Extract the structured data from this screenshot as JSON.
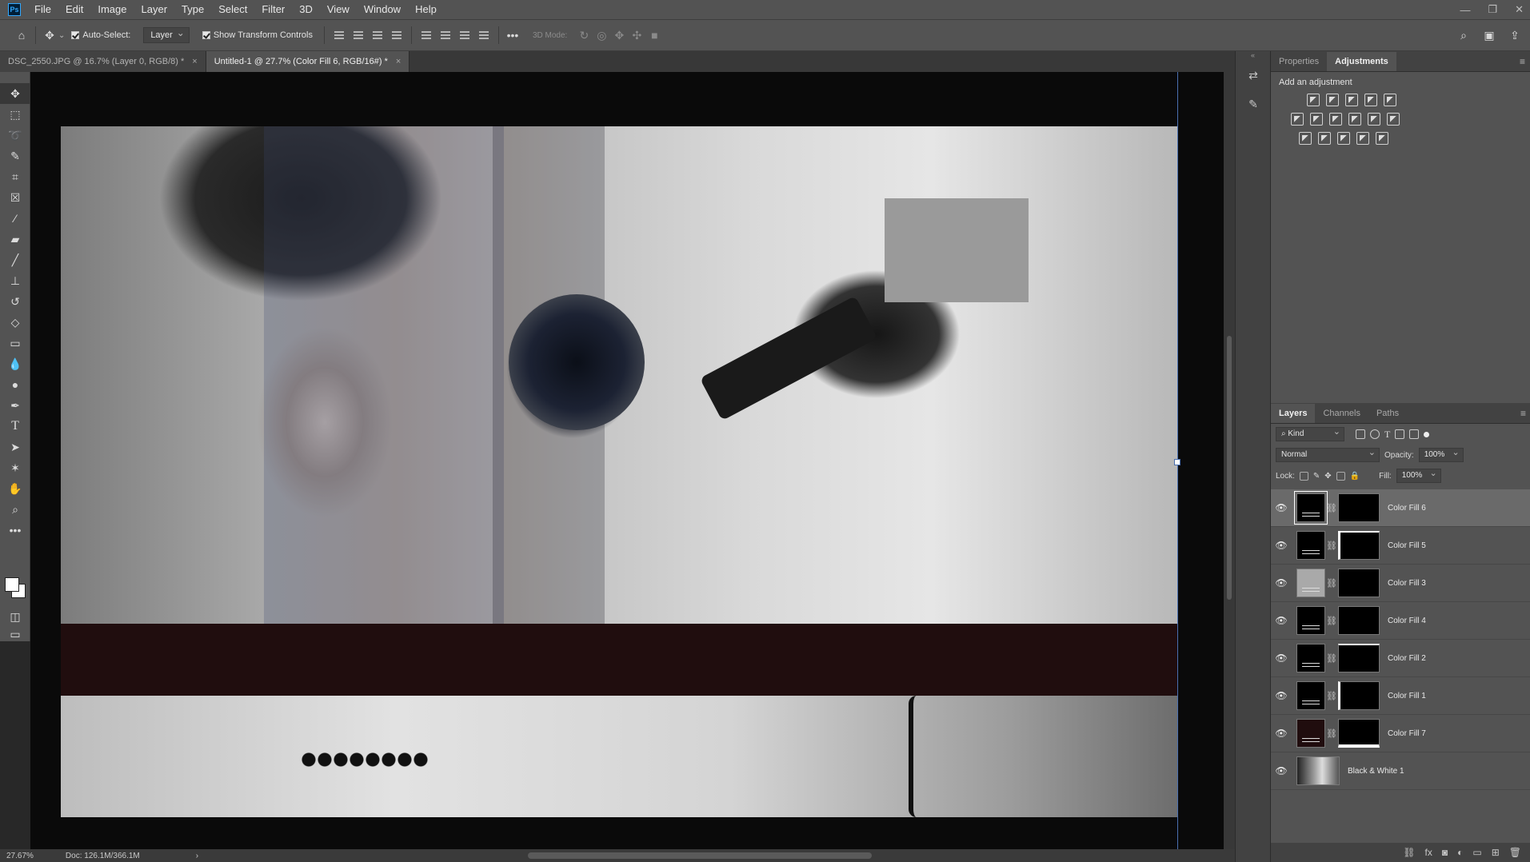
{
  "app": {
    "logo": "Ps"
  },
  "menu": [
    "File",
    "Edit",
    "Image",
    "Layer",
    "Type",
    "Select",
    "Filter",
    "3D",
    "View",
    "Window",
    "Help"
  ],
  "window_controls": {
    "minimize": "—",
    "restore": "❐",
    "close": "✕"
  },
  "options": {
    "auto_select_label": "Auto-Select:",
    "auto_select_value": "Layer",
    "show_transform_label": "Show Transform Controls",
    "more": "•••",
    "mode_3d": "3D Mode:"
  },
  "tabs": [
    {
      "label": "DSC_2550.JPG @ 16.7% (Layer 0, RGB/8) *",
      "close": "×"
    },
    {
      "label": "Untitled-1 @ 27.7% (Color Fill 6, RGB/16#) *",
      "close": "×"
    }
  ],
  "tools": [
    "move-tool",
    "marquee-tool",
    "lasso-tool",
    "quick-select-tool",
    "crop-tool",
    "frame-tool",
    "eyedropper-tool",
    "healing-tool",
    "brush-tool",
    "stamp-tool",
    "history-brush-tool",
    "eraser-tool",
    "gradient-tool",
    "blur-tool",
    "dodge-tool",
    "pen-tool",
    "type-tool",
    "path-select-tool",
    "shape-tool",
    "hand-tool",
    "zoom-tool",
    "edit-toolbar"
  ],
  "status": {
    "zoom": "27.67%",
    "doc": "Doc: 126.1M/366.1M",
    "arrow": "›"
  },
  "adjust_panel": {
    "tabs": [
      "Properties",
      "Adjustments"
    ],
    "active_tab": "Adjustments",
    "title": "Add an adjustment",
    "rows": [
      5,
      6,
      5
    ]
  },
  "layers_panel": {
    "tabs": [
      "Layers",
      "Channels",
      "Paths"
    ],
    "filter_kind": "Kind",
    "blend_mode": "Normal",
    "opacity_label": "Opacity:",
    "opacity_value": "100%",
    "lock_label": "Lock:",
    "fill_label": "Fill:",
    "fill_value": "100%",
    "layers": [
      {
        "name": "Color Fill 6",
        "selected": true,
        "thumb_color": "#000000"
      },
      {
        "name": "Color Fill 5",
        "selected": false,
        "thumb_color": "#000000"
      },
      {
        "name": "Color Fill 3",
        "selected": false,
        "thumb_color": "#a9a9a9"
      },
      {
        "name": "Color Fill 4",
        "selected": false,
        "thumb_color": "#000000"
      },
      {
        "name": "Color Fill 2",
        "selected": false,
        "thumb_color": "#000000"
      },
      {
        "name": "Color Fill 1",
        "selected": false,
        "thumb_color": "#000000"
      },
      {
        "name": "Color Fill 7",
        "selected": false,
        "thumb_color": "#200d0e"
      }
    ],
    "bottom_layer": {
      "name": "Black & White 1"
    }
  },
  "colors": {
    "band": "#200d0e",
    "guide": "#4a6fb0",
    "accent": "#31a8ff"
  }
}
